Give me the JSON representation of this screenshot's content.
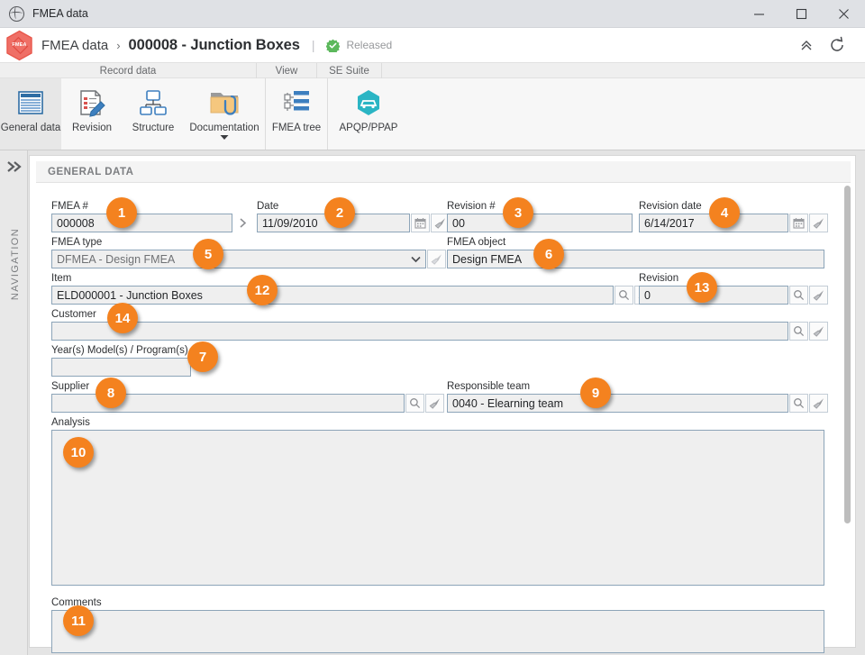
{
  "window": {
    "title": "FMEA data",
    "icon": "globe-icon",
    "controls": {
      "minimize": "minimize-icon",
      "maximize": "maximize-icon",
      "close": "close-icon"
    }
  },
  "header": {
    "logo_text": "FMEA",
    "breadcrumb_root": "FMEA data",
    "breadcrumb_separator": "›",
    "record_title": "000008 - Junction Boxes",
    "divider": "|",
    "status": "Released",
    "status_color": "#5cb85c",
    "actions": [
      {
        "name": "collapse-ribbon-icon",
        "label": "collapse"
      },
      {
        "name": "refresh-icon",
        "label": "refresh"
      }
    ]
  },
  "ribbon": {
    "groups": [
      {
        "label": "Record data"
      },
      {
        "label": "View"
      },
      {
        "label": "SE Suite"
      },
      {
        "label": ""
      }
    ],
    "buttons": [
      {
        "label": "General data",
        "icon": "general-data-icon",
        "active": true,
        "dropdown": false
      },
      {
        "label": "Revision",
        "icon": "revision-icon",
        "active": false,
        "dropdown": false
      },
      {
        "label": "Structure",
        "icon": "structure-icon",
        "active": false,
        "dropdown": false
      },
      {
        "label": "Documentation",
        "icon": "documentation-icon",
        "active": false,
        "dropdown": true
      },
      {
        "label": "FMEA tree",
        "icon": "fmea-tree-icon",
        "active": false,
        "dropdown": false
      },
      {
        "label": "APQP/PPAP",
        "icon": "apqp-ppap-icon",
        "active": false,
        "dropdown": false
      }
    ]
  },
  "navigation": {
    "expand_icon": "double-chevron-right-icon",
    "label": "NAVIGATION"
  },
  "panel": {
    "title": "GENERAL DATA"
  },
  "fields": {
    "fmea_number": {
      "label": "FMEA #",
      "value": "000008",
      "callout": "1"
    },
    "date": {
      "label": "Date",
      "value": "11/09/2010",
      "callout": "2"
    },
    "revision_number": {
      "label": "Revision #",
      "value": "00",
      "callout": "3"
    },
    "revision_date": {
      "label": "Revision date",
      "value": "6/14/2017",
      "callout": "4"
    },
    "fmea_type": {
      "label": "FMEA type",
      "value": "DFMEA - Design FMEA",
      "callout": "5"
    },
    "fmea_object": {
      "label": "FMEA object",
      "value": "Design FMEA",
      "callout": "6"
    },
    "item": {
      "label": "Item",
      "value": "ELD000001 - Junction Boxes",
      "callout": "12"
    },
    "item_revision": {
      "label": "Revision",
      "value": "0",
      "callout": "13"
    },
    "customer": {
      "label": "Customer",
      "value": "",
      "callout": "14"
    },
    "years_models_programs": {
      "label": "Year(s) Model(s) / Program(s)",
      "value": "",
      "callout": "7"
    },
    "supplier": {
      "label": "Supplier",
      "value": "",
      "callout": "8"
    },
    "responsible_team": {
      "label": "Responsible team",
      "value": "0040 - Elearning team",
      "callout": "9"
    },
    "analysis": {
      "label": "Analysis",
      "value": "",
      "callout": "10"
    },
    "comments": {
      "label": "Comments",
      "value": "",
      "callout": "11"
    }
  },
  "colors": {
    "callout": "#f4821f",
    "accent_border": "#8ca4b8",
    "field_bg": "#efefef",
    "status_green": "#5cb85c"
  }
}
